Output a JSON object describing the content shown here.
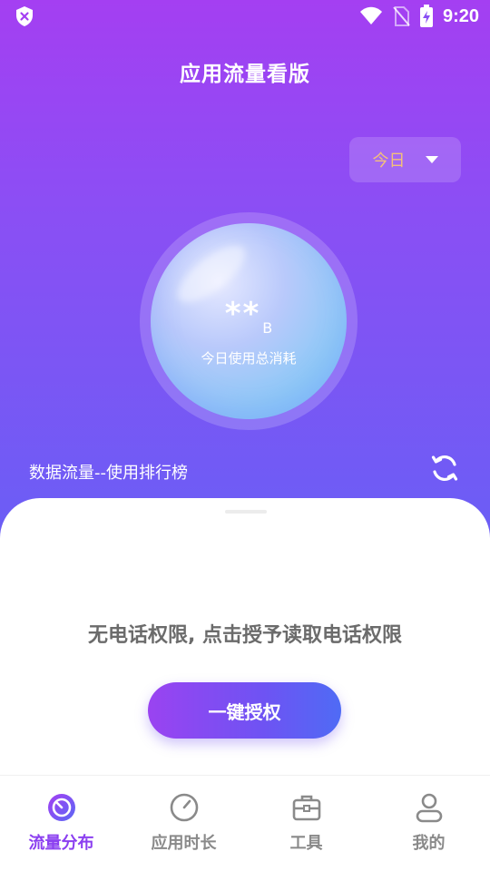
{
  "status_bar": {
    "time": "9:20",
    "icons": [
      "shield-icon",
      "wifi-icon",
      "no-sim-icon",
      "battery-charging-icon"
    ]
  },
  "header": {
    "title": "应用流量看版"
  },
  "period_selector": {
    "selected": "今日",
    "icon": "chevron-down-icon"
  },
  "usage": {
    "value": "**",
    "unit": "B",
    "caption": "今日使用总消耗"
  },
  "ranking": {
    "title": "数据流量--使用排行榜",
    "icon": "refresh-icon"
  },
  "permission": {
    "message": "无电话权限, 点击授予读取电话权限",
    "button_label": "一键授权"
  },
  "tabbar": {
    "items": [
      {
        "label": "流量分布",
        "icon": "traffic-icon",
        "active": true
      },
      {
        "label": "应用时长",
        "icon": "timer-icon",
        "active": false
      },
      {
        "label": "工具",
        "icon": "toolbox-icon",
        "active": false
      },
      {
        "label": "我的",
        "icon": "profile-icon",
        "active": false
      }
    ]
  },
  "colors": {
    "gradient_top": "#a43ff2",
    "gradient_bottom": "#6a5ef5",
    "accent": "#8b3ff0",
    "period_text": "#f4c07a",
    "button_start": "#9a43f1",
    "button_end": "#4f6bf5"
  }
}
